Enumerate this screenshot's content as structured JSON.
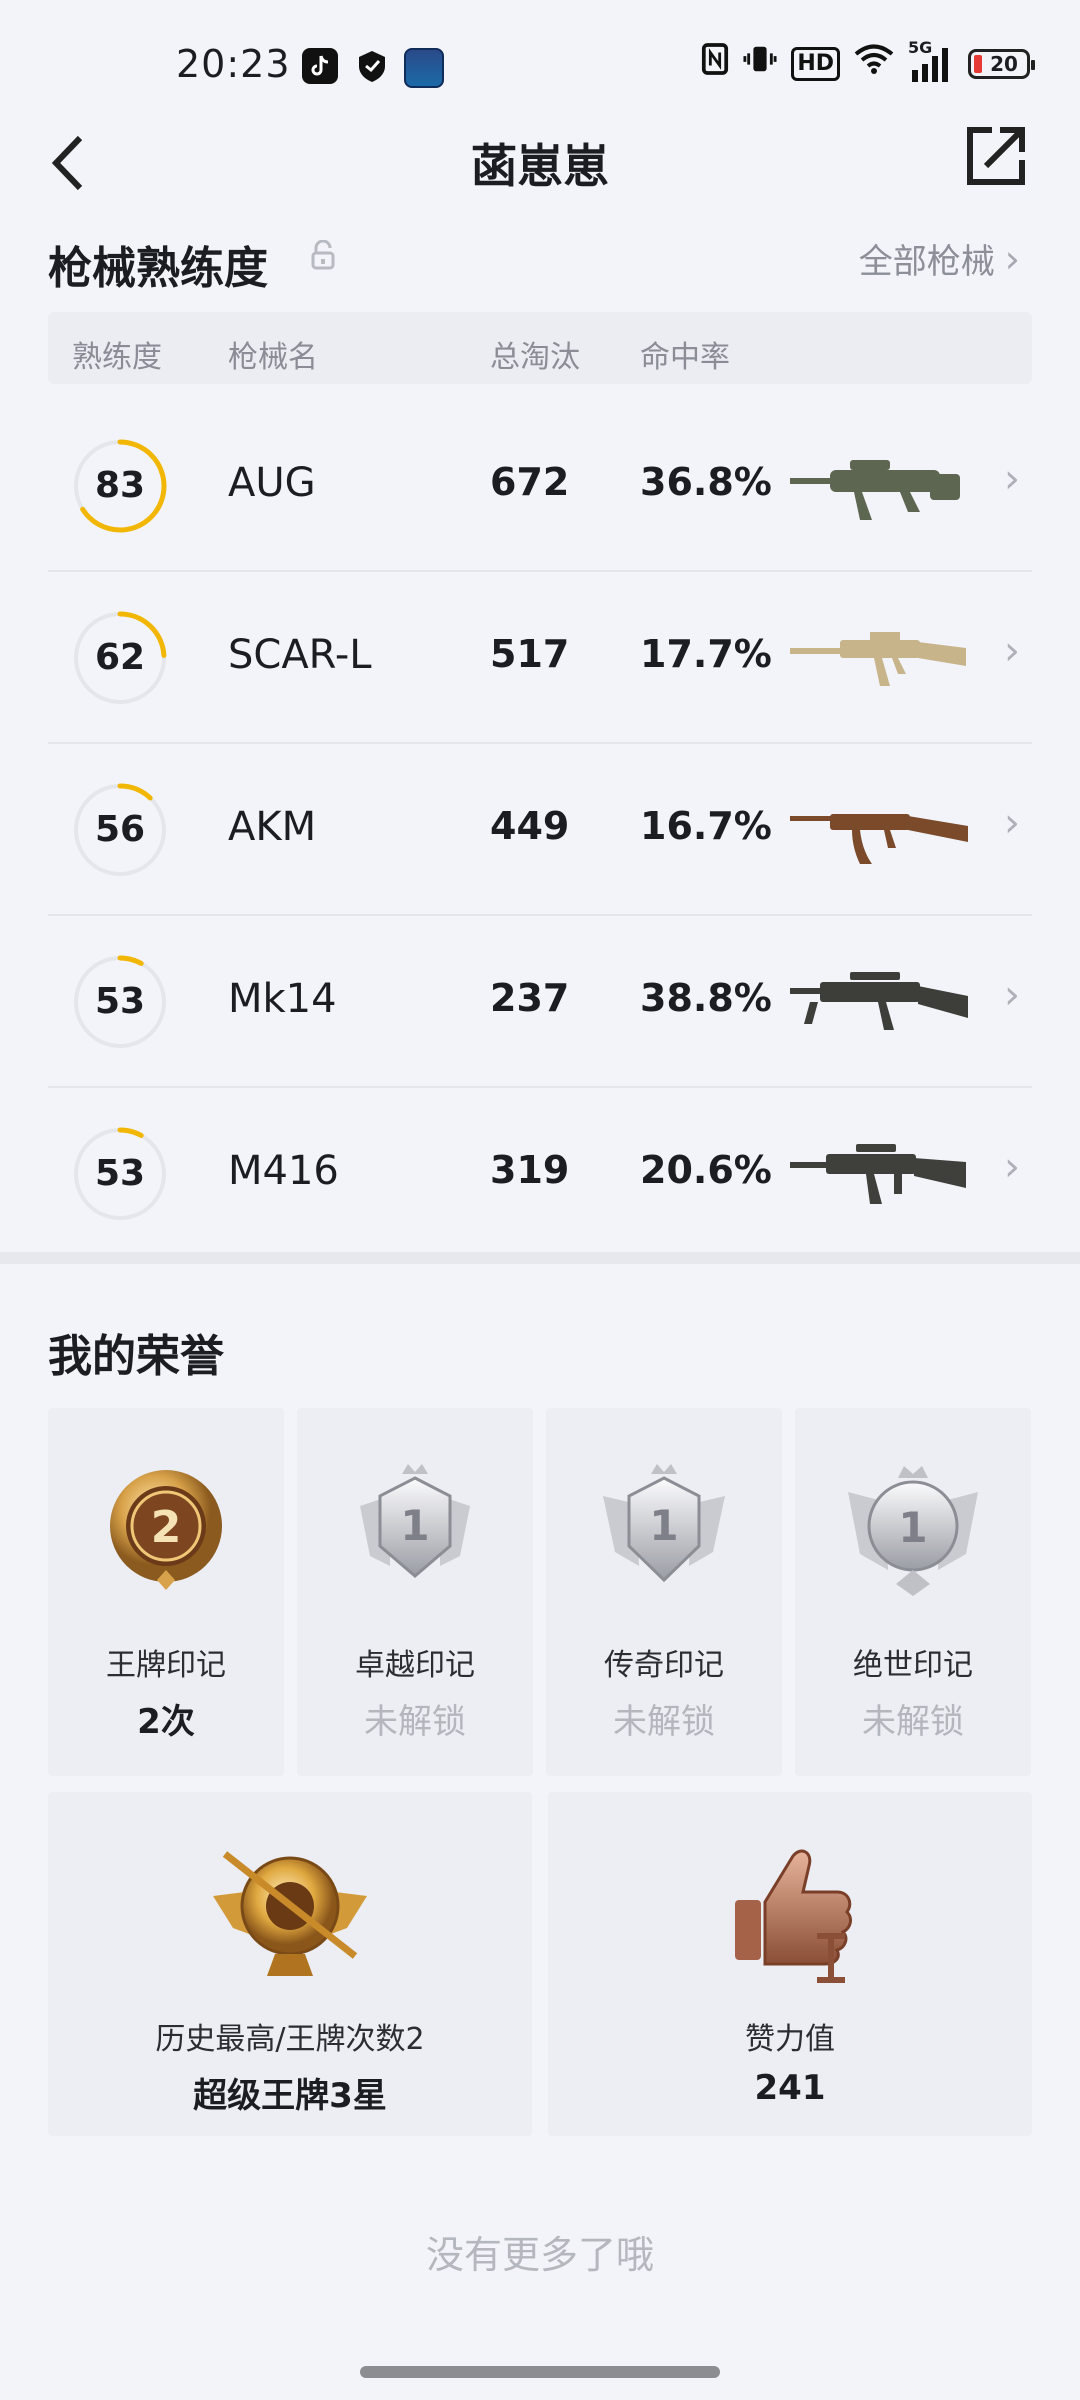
{
  "status_bar": {
    "time": "20:23",
    "network": "5G",
    "hd": "HD",
    "battery": "20"
  },
  "header": {
    "title": "菡崽崽"
  },
  "weapons": {
    "section_title": "枪械熟练度",
    "all_link": "全部枪械",
    "columns": [
      "熟练度",
      "枪械名",
      "总淘汰",
      "命中率"
    ],
    "rows": [
      {
        "proficiency": 83,
        "name": "AUG",
        "kills": "672",
        "accuracy": "36.8%",
        "gun_color": "#5c6651"
      },
      {
        "proficiency": 62,
        "name": "SCAR-L",
        "kills": "517",
        "accuracy": "17.7%",
        "gun_color": "#c8b48b"
      },
      {
        "proficiency": 56,
        "name": "AKM",
        "kills": "449",
        "accuracy": "16.7%",
        "gun_color": "#7a4a2a"
      },
      {
        "proficiency": 53,
        "name": "Mk14",
        "kills": "237",
        "accuracy": "38.8%",
        "gun_color": "#3d3d3a"
      },
      {
        "proficiency": 53,
        "name": "M416",
        "kills": "319",
        "accuracy": "20.6%",
        "gun_color": "#3f403c"
      }
    ]
  },
  "honor": {
    "section_title": "我的荣誉",
    "badges": [
      {
        "name": "王牌印记",
        "value": "2次",
        "locked": false,
        "icon": "ace-mark-icon",
        "badge_num": "2"
      },
      {
        "name": "卓越印记",
        "value": "未解锁",
        "locked": true,
        "icon": "excellence-mark-icon",
        "badge_num": "1"
      },
      {
        "name": "传奇印记",
        "value": "未解锁",
        "locked": true,
        "icon": "legend-mark-icon",
        "badge_num": "1"
      },
      {
        "name": "绝世印记",
        "value": "未解锁",
        "locked": true,
        "icon": "peerless-mark-icon",
        "badge_num": "1"
      }
    ],
    "highest": {
      "name": "历史最高/王牌次数2",
      "value": "超级王牌3星"
    },
    "likes": {
      "name": "赞力值",
      "value": "241"
    }
  },
  "footer": {
    "no_more": "没有更多了哦"
  },
  "colors": {
    "accent": "#f2b705",
    "ring_track": "#e4e6eb"
  }
}
